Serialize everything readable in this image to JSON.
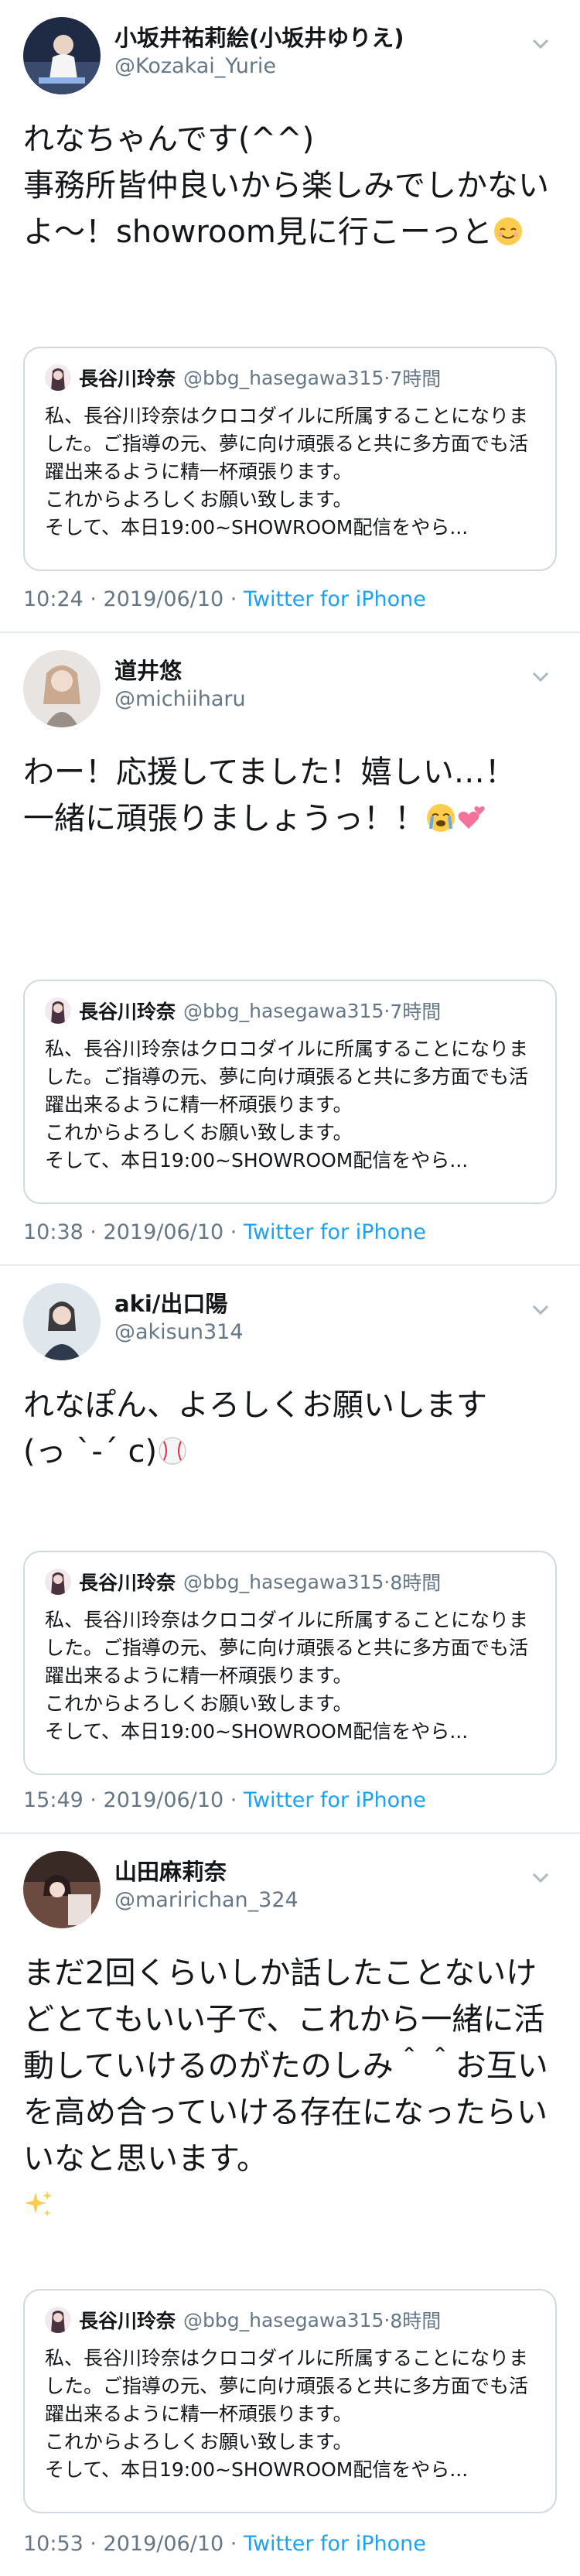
{
  "colors": {
    "link": "#1da1f2",
    "muted": "#657786",
    "border": "#cfd9de"
  },
  "icons": {
    "chevron": "chevron-down-icon"
  },
  "quoted": {
    "display_name": "長谷川玲奈",
    "handle": "@bbg_hasegawa315",
    "text": "私、長谷川玲奈はクロコダイルに所属することになりました。ご指導の元、夢に向け頑張ると共に多方面でも活躍出来るように精一杯頑張ります。\nこれからよろしくお願い致します。\nそして、本日19:00~SHOWROOM配信をやら..."
  },
  "tweets": [
    {
      "display_name": "小坂井祐莉絵(小坂井ゆりえ)",
      "handle": "@Kozakai_Yurie",
      "text_main": "れなちゃんです(^^)\n事務所皆仲良いから楽しみでしかないよ〜！showroom見に行こーっと",
      "emoji": "smiling-face-emoji",
      "quote_time": "7時間",
      "time": "10:24 · 2019/06/10 · ",
      "source": "Twitter for iPhone"
    },
    {
      "display_name": "道井悠",
      "handle": "@michiiharu",
      "text_main": "わー！応援してました！嬉しい…！\n一緒に頑張りましょうっ！！",
      "emoji": "crying-and-hearts-emoji",
      "quote_time": "7時間",
      "time": "10:38 · 2019/06/10 · ",
      "source": "Twitter for iPhone"
    },
    {
      "display_name": "aki/出口陽",
      "handle": "@akisun314",
      "text_main": "れなぽん、よろしくお願いします\n(っ ˋ-ˊ c)",
      "emoji": "baseball-emoji",
      "quote_time": "8時間",
      "time": "15:49 · 2019/06/10 · ",
      "source": "Twitter for iPhone"
    },
    {
      "display_name": "山田麻莉奈",
      "handle": "@maririchan_324",
      "text_main": "まだ2回くらいしか話したことないけどとてもいい子で、これから一緒に活動していけるのがたのしみ＾＾お互いを高め合っていける存在になったらいいなと思います。",
      "emoji": "sparkles-emoji",
      "quote_time": "8時間",
      "time": "10:53 · 2019/06/10 · ",
      "source": "Twitter for iPhone"
    }
  ]
}
